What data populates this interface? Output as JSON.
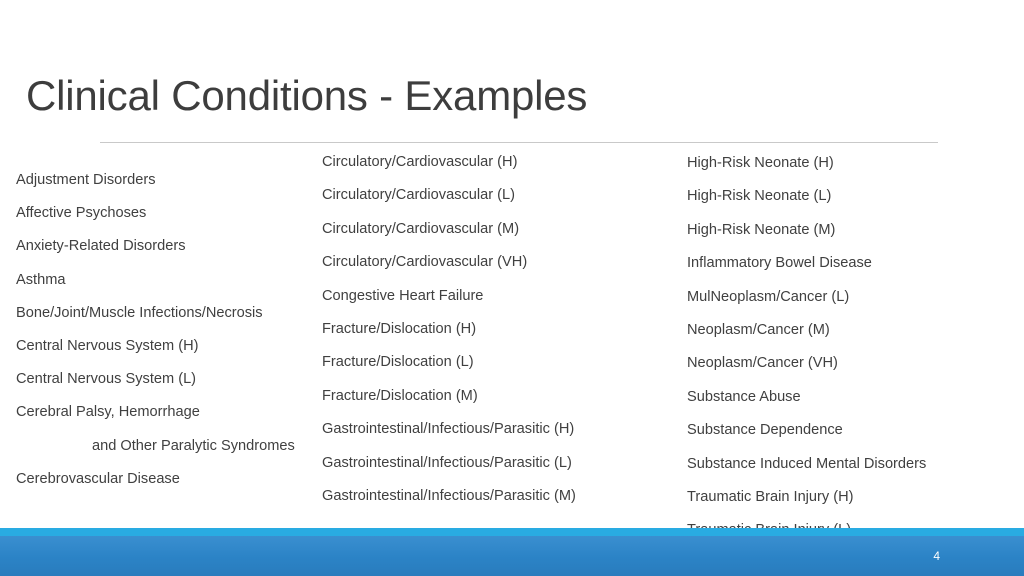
{
  "slide": {
    "title": "Clinical Conditions - Examples",
    "page_number": "4",
    "accent_color": "#29abe2",
    "footer_color": "#2b83c6",
    "text_color": "#404040",
    "title_color": "#3d3d3d",
    "divider_color": "#c9c9c9"
  },
  "columns": [
    {
      "name": "column-1",
      "items": [
        {
          "text": "Adjustment Disorders",
          "indented": false
        },
        {
          "text": "Affective Psychoses",
          "indented": false
        },
        {
          "text": "Anxiety-Related Disorders",
          "indented": false
        },
        {
          "text": "Asthma",
          "indented": false
        },
        {
          "text": "Bone/Joint/Muscle Infections/Necrosis",
          "indented": false
        },
        {
          "text": "Central Nervous System (H)",
          "indented": false
        },
        {
          "text": "Central Nervous System (L)",
          "indented": false
        },
        {
          "text": "Cerebral Palsy, Hemorrhage",
          "indented": false
        },
        {
          "text": "and Other Paralytic Syndromes",
          "indented": true
        },
        {
          "text": "Cerebrovascular Disease",
          "indented": false
        }
      ]
    },
    {
      "name": "column-2",
      "items": [
        {
          "text": "Circulatory/Cardiovascular (H)",
          "indented": false
        },
        {
          "text": "Circulatory/Cardiovascular (L)",
          "indented": false
        },
        {
          "text": "Circulatory/Cardiovascular (M)",
          "indented": false
        },
        {
          "text": "Circulatory/Cardiovascular (VH)",
          "indented": false
        },
        {
          "text": "Congestive Heart Failure",
          "indented": false
        },
        {
          "text": "Fracture/Dislocation (H)",
          "indented": false
        },
        {
          "text": "Fracture/Dislocation (L)",
          "indented": false
        },
        {
          "text": "Fracture/Dislocation (M)",
          "indented": false
        },
        {
          "text": "Gastrointestinal/Infectious/Parasitic (H)",
          "indented": false
        },
        {
          "text": "Gastrointestinal/Infectious/Parasitic (L)",
          "indented": false
        },
        {
          "text": "Gastrointestinal/Infectious/Parasitic (M)",
          "indented": false
        }
      ]
    },
    {
      "name": "column-3",
      "items": [
        {
          "text": "High-Risk Neonate (H)",
          "indented": false
        },
        {
          "text": "High-Risk Neonate (L)",
          "indented": false
        },
        {
          "text": "High-Risk Neonate (M)",
          "indented": false
        },
        {
          "text": "Inflammatory Bowel Disease",
          "indented": false
        },
        {
          "text": "MulNeoplasm/Cancer (L)",
          "indented": false
        },
        {
          "text": "Neoplasm/Cancer (M)",
          "indented": false
        },
        {
          "text": "Neoplasm/Cancer (VH)",
          "indented": false
        },
        {
          "text": "Substance Abuse",
          "indented": false
        },
        {
          "text": "Substance Dependence",
          "indented": false
        },
        {
          "text": "Substance Induced Mental Disorders",
          "indented": false
        },
        {
          "text": "Traumatic Brain Injury (H)",
          "indented": false
        },
        {
          "text": "Traumatic Brain Injury (L)",
          "indented": false
        }
      ]
    }
  ]
}
